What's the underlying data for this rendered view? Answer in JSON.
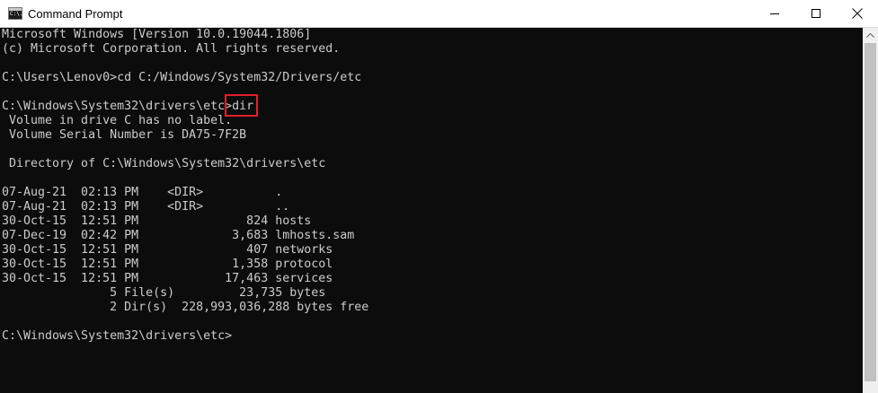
{
  "window": {
    "title": "Command Prompt",
    "icon_text": "C:\\."
  },
  "console": {
    "lines": [
      "Microsoft Windows [Version 10.0.19044.1806]",
      "(c) Microsoft Corporation. All rights reserved.",
      "",
      "C:\\Users\\Lenov0>cd C:/Windows/System32/Drivers/etc",
      "",
      "C:\\Windows\\System32\\drivers\\etc>dir",
      " Volume in drive C has no label.",
      " Volume Serial Number is DA75-7F2B",
      "",
      " Directory of C:\\Windows\\System32\\drivers\\etc",
      "",
      "07-Aug-21  02:13 PM    <DIR>          .",
      "07-Aug-21  02:13 PM    <DIR>          ..",
      "30-Oct-15  12:51 PM               824 hosts",
      "07-Dec-19  02:42 PM             3,683 lmhosts.sam",
      "30-Oct-15  12:51 PM               407 networks",
      "30-Oct-15  12:51 PM             1,358 protocol",
      "30-Oct-15  12:51 PM            17,463 services",
      "               5 File(s)         23,735 bytes",
      "               2 Dir(s)  228,993,036,288 bytes free",
      "",
      "C:\\Windows\\System32\\drivers\\etc>"
    ]
  },
  "colors": {
    "console_bg": "#0c0c0c",
    "console_text": "#cccccc",
    "highlight_border": "#e0202a"
  },
  "icons": {
    "app": "command-prompt-icon",
    "minimize": "minimize-icon",
    "maximize": "maximize-icon",
    "close": "close-icon",
    "scroll_up": "chevron-up-icon"
  }
}
